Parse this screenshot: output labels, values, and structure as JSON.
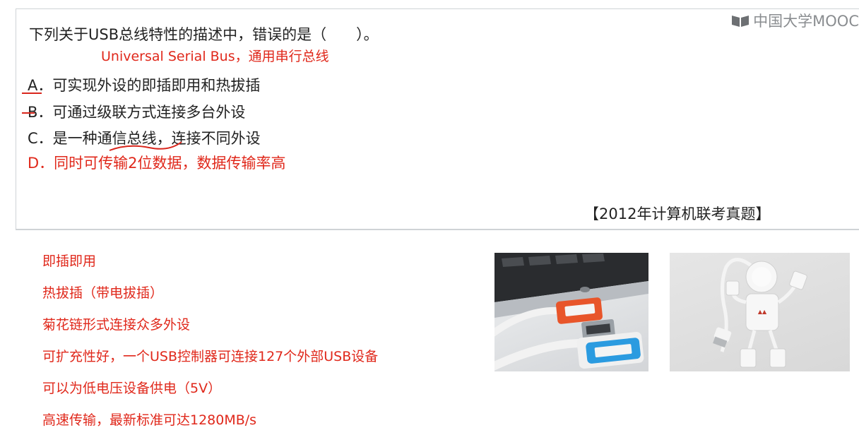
{
  "watermark": {
    "text": "中国大学MOOC",
    "icon": "mooc-book-icon"
  },
  "question": {
    "title": "下列关于USB总线特性的描述中，错误的是（　　）。",
    "note": "Universal Serial Bus，通用串行总线",
    "options": [
      {
        "label": "A．可实现外设的即插即用和热拔插",
        "correct": false
      },
      {
        "label": "B．可通过级联方式连接多台外设",
        "correct": false
      },
      {
        "label": "C．是一种通信总线，连接不同外设",
        "correct": false
      },
      {
        "label": "D．同时可传输2位数据，数据传输率高",
        "correct": true
      }
    ],
    "source": "【2012年计算机联考真题】"
  },
  "notes": [
    "即插即用",
    "热拔插（带电拔插）",
    "菊花链形式连接众多外设",
    "可扩充性好，一个USB控制器可连接127个外部USB设备",
    "可以为低电压设备供电（5V）",
    "高速传输，最新标准可达1280MB/s"
  ],
  "colors": {
    "answer_red": "#e0281b",
    "text_dark": "#222222",
    "border_gray": "#cfd3d6",
    "usb_orange": "#e8552a",
    "usb_blue": "#2b9be0"
  },
  "images": {
    "usb_cable": "usb-cable-photo",
    "usb_hub": "usb-hub-robot-photo"
  }
}
